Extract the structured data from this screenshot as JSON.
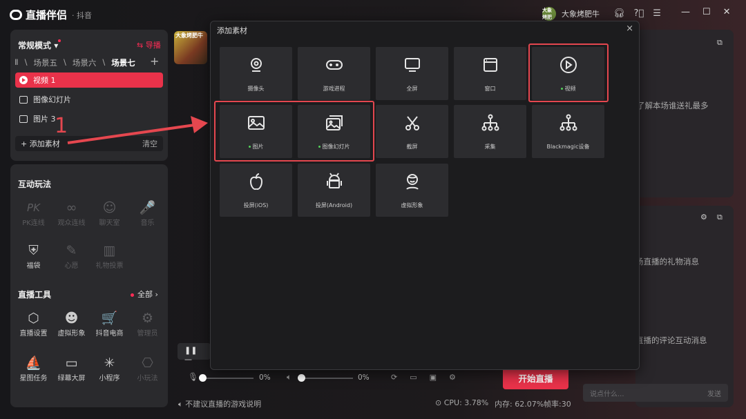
{
  "app": {
    "name": "直播伴侣",
    "platform": "· 抖音",
    "user": "大象烤肥牛",
    "avatar_text": "大象烤肥"
  },
  "left": {
    "mode": "常规模式",
    "guide": "导播",
    "scenes": [
      "Ⅱ",
      "场景五",
      "场景六",
      "场景七"
    ],
    "sources": [
      {
        "label": "视频 1",
        "icon": "play-icon",
        "selected": true
      },
      {
        "label": "图像幻灯片",
        "icon": "slideshow-icon",
        "selected": false
      },
      {
        "label": "图片 3",
        "icon": "image-icon",
        "selected": false
      }
    ],
    "add_source": "添加素材",
    "clear": "清空",
    "interactive_title": "互动玩法",
    "interactive": [
      {
        "glyph": "PK",
        "label": "PK连线",
        "enabled": false
      },
      {
        "glyph": "∞",
        "label": "观众连线",
        "enabled": false
      },
      {
        "glyph": "☺",
        "label": "聊天室",
        "enabled": false
      },
      {
        "glyph": "🎤",
        "label": "音乐",
        "enabled": false
      },
      {
        "glyph": "⛨",
        "label": "福袋",
        "enabled": true
      },
      {
        "glyph": "✎",
        "label": "心愿",
        "enabled": false
      },
      {
        "glyph": "▥",
        "label": "礼物投票",
        "enabled": false
      }
    ],
    "tools_title": "直播工具",
    "tools_all": "全部 ›",
    "tools": [
      {
        "glyph": "⬡",
        "label": "直播设置",
        "enabled": true
      },
      {
        "glyph": "☻",
        "label": "虚拟形象",
        "enabled": true
      },
      {
        "glyph": "🛒",
        "label": "抖音电商",
        "enabled": true
      },
      {
        "glyph": "⚙",
        "label": "管理员",
        "enabled": false
      },
      {
        "glyph": "⛵",
        "label": "星图任务",
        "enabled": true
      },
      {
        "glyph": "▭",
        "label": "绿幕大屏",
        "enabled": true
      },
      {
        "glyph": "✳",
        "label": "小程序",
        "enabled": true
      },
      {
        "glyph": "⎔",
        "label": "小玩法",
        "enabled": false
      }
    ],
    "annotation_number": "1"
  },
  "preview": {
    "thumb_text": "大象烤肥牛"
  },
  "bottom": {
    "mic_percent": "0%",
    "speaker_percent": "0%",
    "start_button": "开始直播",
    "notice": "不建议直播的游戏说明",
    "cpu": "CPU: 3.78%",
    "memory": "内存: 62.07%",
    "fps": "帧率:30"
  },
  "right": {
    "text1": "了解本场谁送礼最多",
    "text2": "场直播的礼物消息",
    "text3": "直播的评论互动消息",
    "comment_placeholder": "说点什么...",
    "send": "发送"
  },
  "modal": {
    "title": "添加素材",
    "close": "×",
    "tiles": [
      {
        "label": "摄像头",
        "icon": "camera-icon",
        "dot": false
      },
      {
        "label": "游戏进程",
        "icon": "gamepad-icon",
        "dot": false
      },
      {
        "label": "全屏",
        "icon": "monitor-icon",
        "dot": false
      },
      {
        "label": "窗口",
        "icon": "window-icon",
        "dot": false
      },
      {
        "label": "视频",
        "icon": "play-circle-icon",
        "dot": true
      },
      {
        "label": "图片",
        "icon": "image-icon",
        "dot": true
      },
      {
        "label": "图像幻灯片",
        "icon": "slideshow-icon",
        "dot": true
      },
      {
        "label": "截屏",
        "icon": "scissors-icon",
        "dot": false
      },
      {
        "label": "采集",
        "icon": "capture-tree-icon",
        "dot": false
      },
      {
        "label": "Blackmagic设备",
        "icon": "blackmagic-tree-icon",
        "dot": false
      },
      {
        "label": "投屏(iOS)",
        "icon": "apple-icon",
        "dot": false
      },
      {
        "label": "投屏(Android)",
        "icon": "android-icon",
        "dot": false
      },
      {
        "label": "虚拟形象",
        "icon": "avatar-icon",
        "dot": false
      }
    ]
  },
  "colors": {
    "accent": "#e9324a",
    "highlight_box": "#e5474f",
    "status_dot": "#53d15a"
  }
}
